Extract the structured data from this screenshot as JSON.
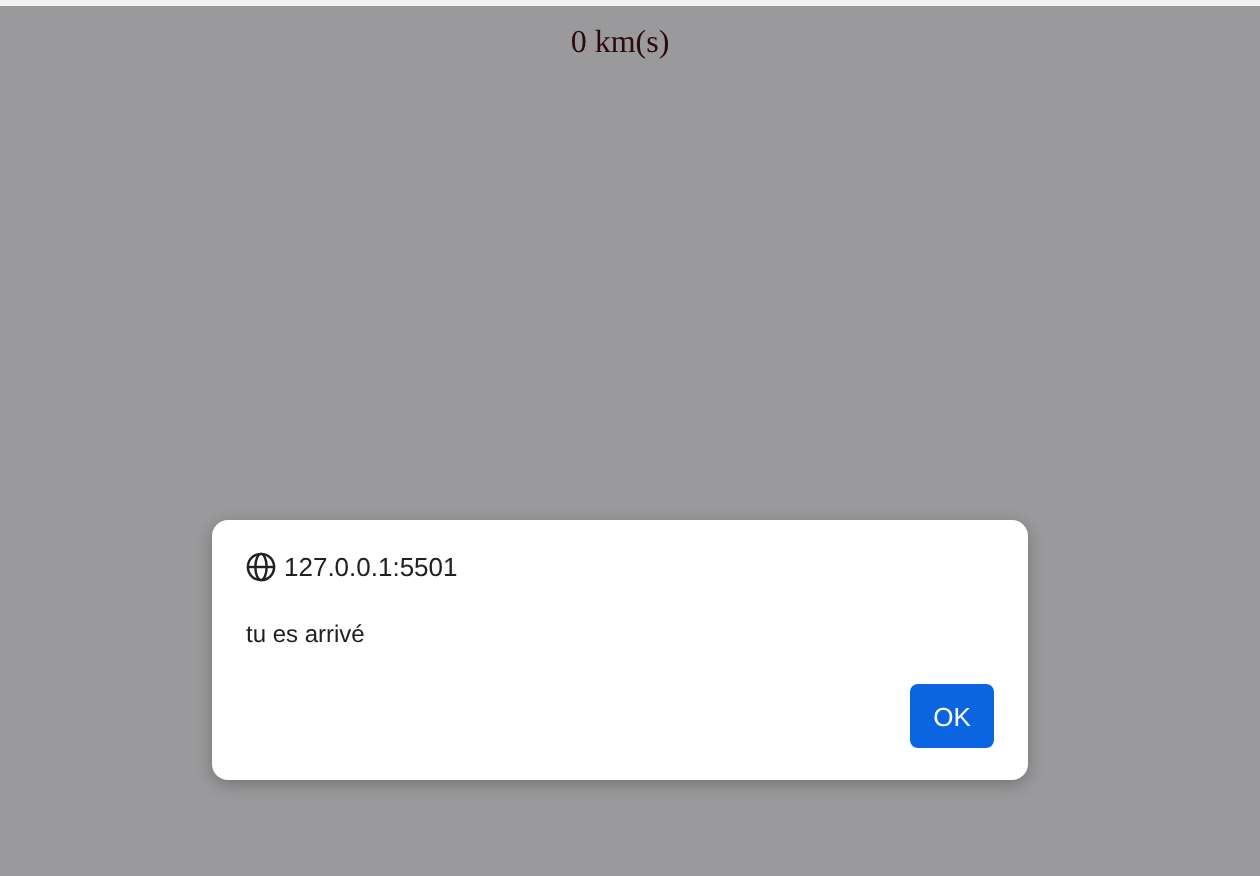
{
  "page": {
    "text": "0 km(s)"
  },
  "dialog": {
    "origin": "127.0.0.1:5501",
    "message": "tu es arrivé",
    "buttons": [
      "OK"
    ]
  }
}
